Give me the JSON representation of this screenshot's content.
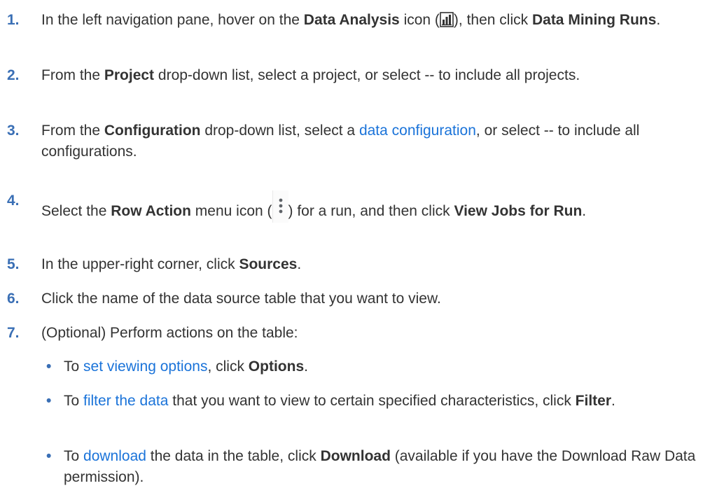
{
  "steps": [
    {
      "num": "1.",
      "parts": [
        "In the left navigation pane, hover on the ",
        "Data Analysis",
        " icon (",
        "), then click ",
        "Data Mining Runs",
        "."
      ]
    },
    {
      "num": "2.",
      "parts": [
        "From the ",
        "Project",
        " drop-down list, select a project, or select -- to include all projects."
      ]
    },
    {
      "num": "3.",
      "parts": [
        "From the ",
        "Configuration",
        " drop-down list, select a ",
        "data configuration",
        ", or select -- to include all configurations."
      ]
    },
    {
      "num": "4.",
      "parts": [
        "Select the ",
        "Row Action",
        " menu icon (",
        ") for a run, and then click ",
        "View Jobs for Run",
        "."
      ]
    },
    {
      "num": "5.",
      "parts": [
        "In the upper-right corner, click ",
        "Sources",
        "."
      ]
    },
    {
      "num": "6.",
      "parts": [
        "Click the name of the data source table that you want to view."
      ]
    },
    {
      "num": "7.",
      "parts": [
        "(Optional) Perform actions on the table:"
      ]
    }
  ],
  "bullets": [
    {
      "mark": "•",
      "parts": [
        "To ",
        "set viewing options",
        ", click ",
        "Options",
        "."
      ]
    },
    {
      "mark": "•",
      "parts": [
        "To ",
        "filter the data",
        " that you want to view to certain specified characteristics, click ",
        "Filter",
        "."
      ]
    },
    {
      "mark": "•",
      "parts": [
        "To ",
        "download",
        " the data in the table, click ",
        "Download",
        " (available if you have the Download Raw Data permission)."
      ]
    }
  ],
  "icons": {
    "data_analysis": "data-analysis-icon",
    "row_action": "kebab-menu-icon"
  },
  "colors": {
    "step_number": "#3a6fb5",
    "link": "#1a73d9",
    "text": "#333333"
  }
}
